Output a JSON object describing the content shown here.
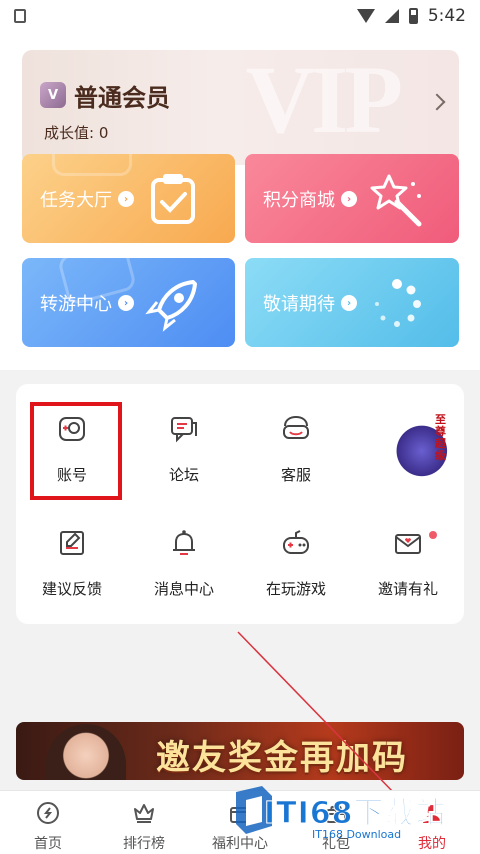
{
  "status_bar": {
    "time": "5:42"
  },
  "member": {
    "watermark": "VIP",
    "badge": "V",
    "title": "普通会员",
    "growth_label": "成长值: 0"
  },
  "tiles": {
    "task": {
      "label": "任务大厅"
    },
    "points": {
      "label": "积分商城"
    },
    "transfer": {
      "label": "转游中心"
    },
    "coming": {
      "label": "敬请期待"
    }
  },
  "grid": {
    "items": [
      {
        "label": "账号",
        "icon": "account-icon"
      },
      {
        "label": "论坛",
        "icon": "forum-icon"
      },
      {
        "label": "客服",
        "icon": "customer-service-icon"
      },
      {
        "label": "",
        "icon": "promo-game-icon"
      },
      {
        "label": "建议反馈",
        "icon": "feedback-icon"
      },
      {
        "label": "消息中心",
        "icon": "bell-icon"
      },
      {
        "label": "在玩游戏",
        "icon": "gamepad-icon"
      },
      {
        "label": "邀请有礼",
        "icon": "gift-envelope-icon"
      }
    ]
  },
  "promo_thumb": {
    "text": "至尊超级"
  },
  "banner": {
    "text": "邀友奖金再加码"
  },
  "tabbar": {
    "tabs": [
      {
        "label": "首页",
        "icon": "home-coin-icon"
      },
      {
        "label": "排行榜",
        "icon": "crown-icon"
      },
      {
        "label": "福利中心",
        "icon": "welfare-icon"
      },
      {
        "label": "礼包",
        "icon": "gift-icon"
      },
      {
        "label": "我的",
        "icon": "profile-icon",
        "active": true
      }
    ]
  },
  "overlay": {
    "site_name": "ITI68下载站",
    "site_sub": "IT168 Download"
  },
  "colors": {
    "highlight": "#e0141b",
    "active_tab": "#e02b3a",
    "arrow": "#d9343f"
  }
}
